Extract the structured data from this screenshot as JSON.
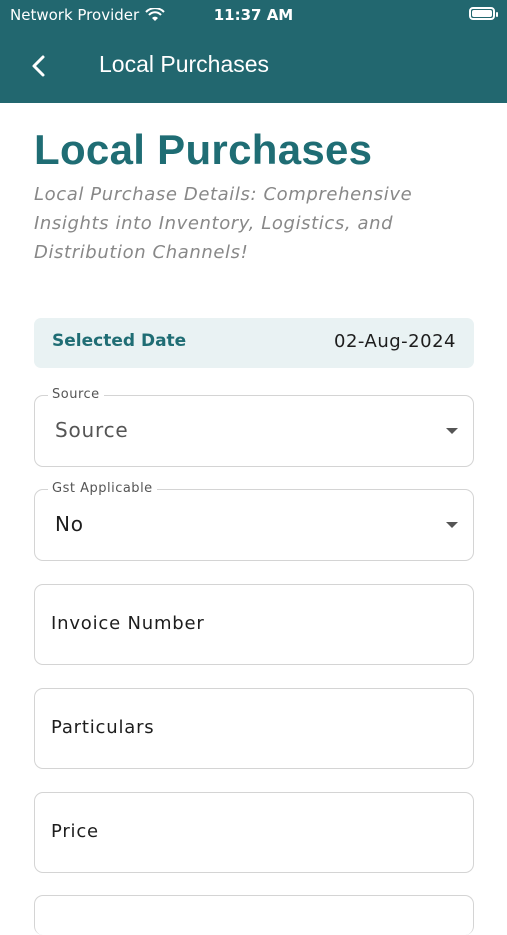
{
  "status_bar": {
    "carrier": "Network Provider",
    "time": "11:37 AM"
  },
  "nav": {
    "title": "Local Purchases"
  },
  "page": {
    "title": "Local Purchases",
    "subtitle": "Local Purchase Details: Comprehensive Insights into Inventory, Logistics, and Distribution Channels!"
  },
  "date": {
    "label": "Selected Date",
    "value": "02-Aug-2024"
  },
  "form": {
    "source": {
      "label": "Source",
      "value": "Source"
    },
    "gst": {
      "label": "Gst Applicable",
      "value": "No"
    },
    "invoice": {
      "placeholder": "Invoice Number"
    },
    "particulars": {
      "placeholder": "Particulars"
    },
    "price": {
      "placeholder": "Price"
    }
  },
  "colors": {
    "header": "#22676f",
    "accent": "#1f6d74",
    "date_bg": "#e9f2f3"
  }
}
